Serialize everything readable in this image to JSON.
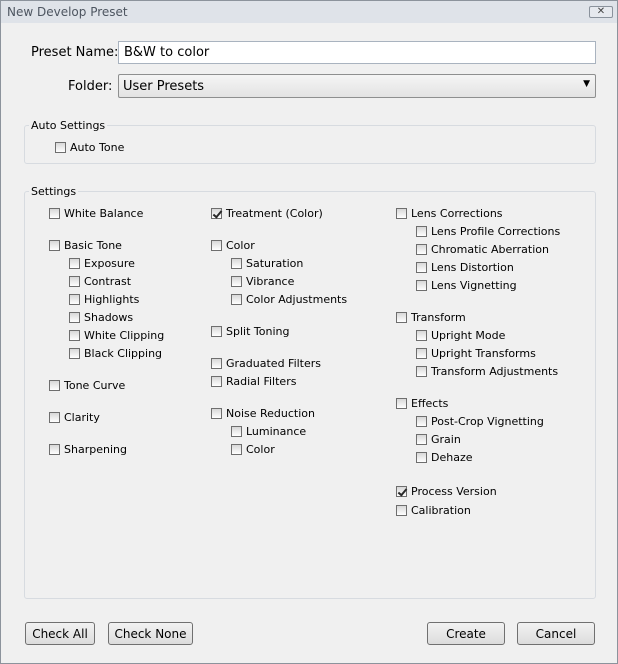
{
  "window": {
    "title": "New Develop Preset",
    "close_symbol": "✕"
  },
  "form": {
    "preset_label": "Preset Name:",
    "preset_value": "B&W to color",
    "folder_label": "Folder:",
    "folder_value": "User Presets"
  },
  "auto_settings": {
    "legend": "Auto Settings",
    "items": [
      {
        "label": "Auto Tone",
        "checked": false
      }
    ]
  },
  "settings": {
    "legend": "Settings",
    "items": [
      {
        "id": "white-balance",
        "label": "White Balance",
        "checked": false
      },
      {
        "id": "basic-tone",
        "label": "Basic Tone",
        "checked": false
      },
      {
        "id": "exposure",
        "label": "Exposure",
        "checked": false
      },
      {
        "id": "contrast",
        "label": "Contrast",
        "checked": false
      },
      {
        "id": "highlights",
        "label": "Highlights",
        "checked": false
      },
      {
        "id": "shadows",
        "label": "Shadows",
        "checked": false
      },
      {
        "id": "white-clipping",
        "label": "White Clipping",
        "checked": false
      },
      {
        "id": "black-clipping",
        "label": "Black Clipping",
        "checked": false
      },
      {
        "id": "tone-curve",
        "label": "Tone Curve",
        "checked": false
      },
      {
        "id": "clarity",
        "label": "Clarity",
        "checked": false
      },
      {
        "id": "sharpening",
        "label": "Sharpening",
        "checked": false
      },
      {
        "id": "treatment",
        "label": "Treatment (Color)",
        "checked": true
      },
      {
        "id": "color",
        "label": "Color",
        "checked": false
      },
      {
        "id": "saturation",
        "label": "Saturation",
        "checked": false
      },
      {
        "id": "vibrance",
        "label": "Vibrance",
        "checked": false
      },
      {
        "id": "color-adjustments",
        "label": "Color Adjustments",
        "checked": false
      },
      {
        "id": "split-toning",
        "label": "Split Toning",
        "checked": false
      },
      {
        "id": "graduated-filters",
        "label": "Graduated Filters",
        "checked": false
      },
      {
        "id": "radial-filters",
        "label": "Radial Filters",
        "checked": false
      },
      {
        "id": "noise-reduction",
        "label": "Noise Reduction",
        "checked": false
      },
      {
        "id": "luminance",
        "label": "Luminance",
        "checked": false
      },
      {
        "id": "nr-color",
        "label": "Color",
        "checked": false
      },
      {
        "id": "lens-corrections",
        "label": "Lens Corrections",
        "checked": false
      },
      {
        "id": "lens-profile-corrections",
        "label": "Lens Profile Corrections",
        "checked": false
      },
      {
        "id": "chromatic-aberration",
        "label": "Chromatic Aberration",
        "checked": false
      },
      {
        "id": "lens-distortion",
        "label": "Lens Distortion",
        "checked": false
      },
      {
        "id": "lens-vignetting",
        "label": "Lens Vignetting",
        "checked": false
      },
      {
        "id": "transform",
        "label": "Transform",
        "checked": false
      },
      {
        "id": "upright-mode",
        "label": "Upright Mode",
        "checked": false
      },
      {
        "id": "upright-transforms",
        "label": "Upright Transforms",
        "checked": false
      },
      {
        "id": "transform-adjustments",
        "label": "Transform Adjustments",
        "checked": false
      },
      {
        "id": "effects",
        "label": "Effects",
        "checked": false
      },
      {
        "id": "post-crop-vignetting",
        "label": "Post-Crop Vignetting",
        "checked": false
      },
      {
        "id": "grain",
        "label": "Grain",
        "checked": false
      },
      {
        "id": "dehaze",
        "label": "Dehaze",
        "checked": false
      },
      {
        "id": "process-version",
        "label": "Process Version",
        "checked": true
      },
      {
        "id": "calibration",
        "label": "Calibration",
        "checked": false
      }
    ]
  },
  "buttons": {
    "check_all": "Check All",
    "check_none": "Check None",
    "create": "Create",
    "cancel": "Cancel"
  }
}
